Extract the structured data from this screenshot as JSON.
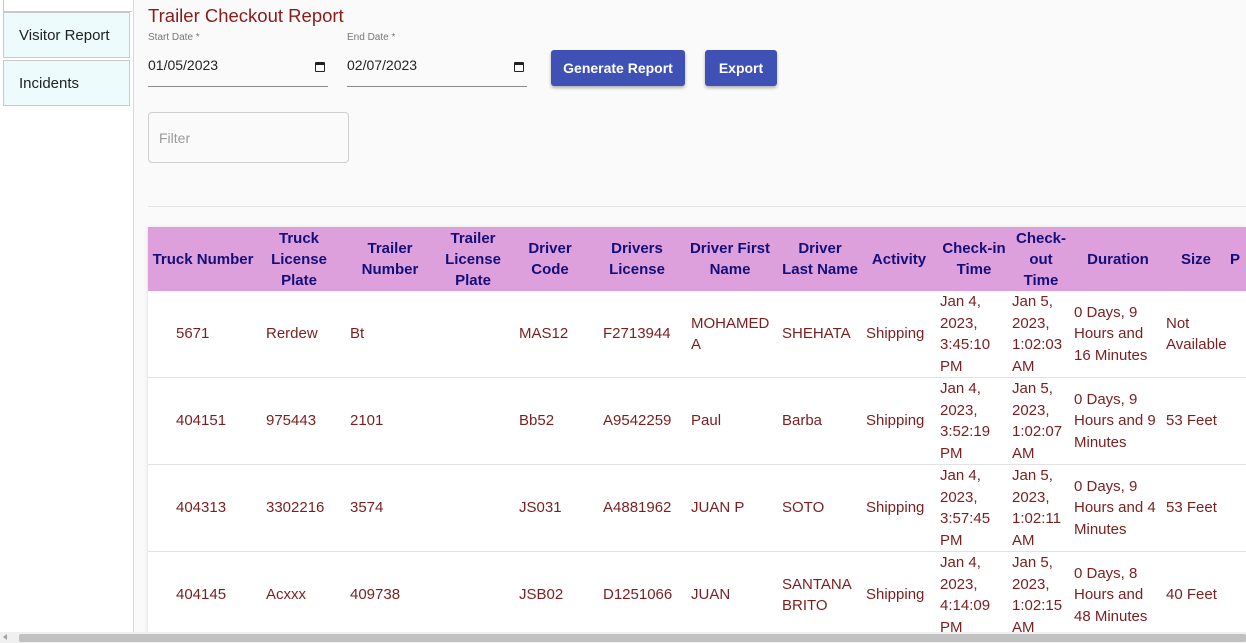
{
  "sidebar": {
    "items": [
      {
        "label": "Visitor Report"
      },
      {
        "label": "Incidents"
      }
    ]
  },
  "page": {
    "title": "Trailer Checkout Report"
  },
  "form": {
    "start_date": {
      "label": "Start Date *",
      "value": "01/05/2023"
    },
    "end_date": {
      "label": "End Date *",
      "value": "02/07/2023"
    },
    "generate_label": "Generate Report",
    "export_label": "Export",
    "filter_placeholder": "Filter"
  },
  "colors": {
    "accent": "#3f51b5",
    "header_bg": "#dda0dd",
    "header_text": "#140f78",
    "cell_text": "#7a1f1f",
    "title": "#8b1a1a"
  },
  "table": {
    "columns": [
      "Truck Number",
      "Truck License Plate",
      "Trailer Number",
      "Trailer License Plate",
      "Driver Code",
      "Drivers License",
      "Driver First Name",
      "Driver Last Name",
      "Activity",
      "Check-in Time",
      "Check-out Time",
      "Duration",
      "Size",
      "P"
    ],
    "rows": [
      [
        "5671",
        "Rerdew",
        "Bt",
        "",
        "MAS12",
        "F2713944",
        "MOHAMED A",
        "SHEHATA",
        "Shipping",
        "Jan 4, 2023, 3:45:10 PM",
        "Jan 5, 2023, 1:02:03 AM",
        "0 Days, 9 Hours and 16 Minutes",
        "Not Available",
        ""
      ],
      [
        "404151",
        "975443",
        "2101",
        "",
        "Bb52",
        "A9542259",
        "Paul",
        "Barba",
        "Shipping",
        "Jan 4, 2023, 3:52:19 PM",
        "Jan 5, 2023, 1:02:07 AM",
        "0 Days, 9 Hours and 9 Minutes",
        "53 Feet",
        ""
      ],
      [
        "404313",
        "3302216",
        "3574",
        "",
        "JS031",
        "A4881962",
        "JUAN P",
        "SOTO",
        "Shipping",
        "Jan 4, 2023, 3:57:45 PM",
        "Jan 5, 2023, 1:02:11 AM",
        "0 Days, 9 Hours and 4 Minutes",
        "53 Feet",
        ""
      ],
      [
        "404145",
        "Acxxx",
        "409738",
        "",
        "JSB02",
        "D1251066",
        "JUAN",
        "SANTANA BRITO",
        "Shipping",
        "Jan 4, 2023, 4:14:09 PM",
        "Jan 5, 2023, 1:02:15 AM",
        "0 Days, 8 Hours and 48 Minutes",
        "40 Feet",
        ""
      ]
    ]
  }
}
